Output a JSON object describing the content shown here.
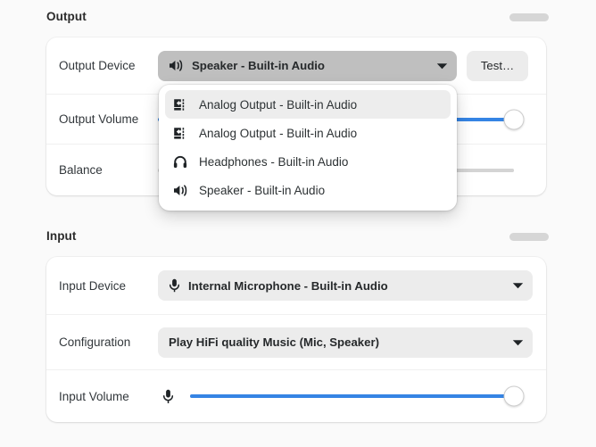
{
  "sections": {
    "output": {
      "title": "Output",
      "handle": "drag-handle"
    },
    "input": {
      "title": "Input",
      "handle": "drag-handle"
    }
  },
  "output_card": {
    "device_row": {
      "label": "Output Device",
      "value": "Speaker - Built-in Audio",
      "icon": "speaker-icon",
      "test_button": "Test…"
    },
    "volume_row": {
      "label": "Output Volume",
      "value_percent": 100,
      "fill_color": "#3584e4"
    },
    "balance_row": {
      "label": "Balance",
      "value_percent": 100,
      "fill_color": "#d4d4d4"
    }
  },
  "dropdown": {
    "open": true,
    "items": [
      {
        "label": "Analog Output - Built-in Audio",
        "icon": "analog-output-icon",
        "highlighted": true
      },
      {
        "label": "Analog Output - Built-in Audio",
        "icon": "analog-output-icon",
        "highlighted": false
      },
      {
        "label": "Headphones - Built-in Audio",
        "icon": "headphones-icon",
        "highlighted": false
      },
      {
        "label": "Speaker - Built-in Audio",
        "icon": "speaker-icon",
        "highlighted": false
      }
    ]
  },
  "input_card": {
    "device_row": {
      "label": "Input Device",
      "value": "Internal Microphone - Built-in Audio",
      "icon": "microphone-icon"
    },
    "config_row": {
      "label": "Configuration",
      "value": "Play HiFi quality Music (Mic, Speaker)"
    },
    "volume_row": {
      "label": "Input Volume",
      "icon": "microphone-icon",
      "value_percent": 100,
      "fill_color": "#3584e4"
    }
  },
  "colors": {
    "accent": "#3584e4",
    "page_background": "#fafafa",
    "card_background": "#ffffff",
    "control_background": "#ececec",
    "control_active_background": "#bfbfbf"
  }
}
